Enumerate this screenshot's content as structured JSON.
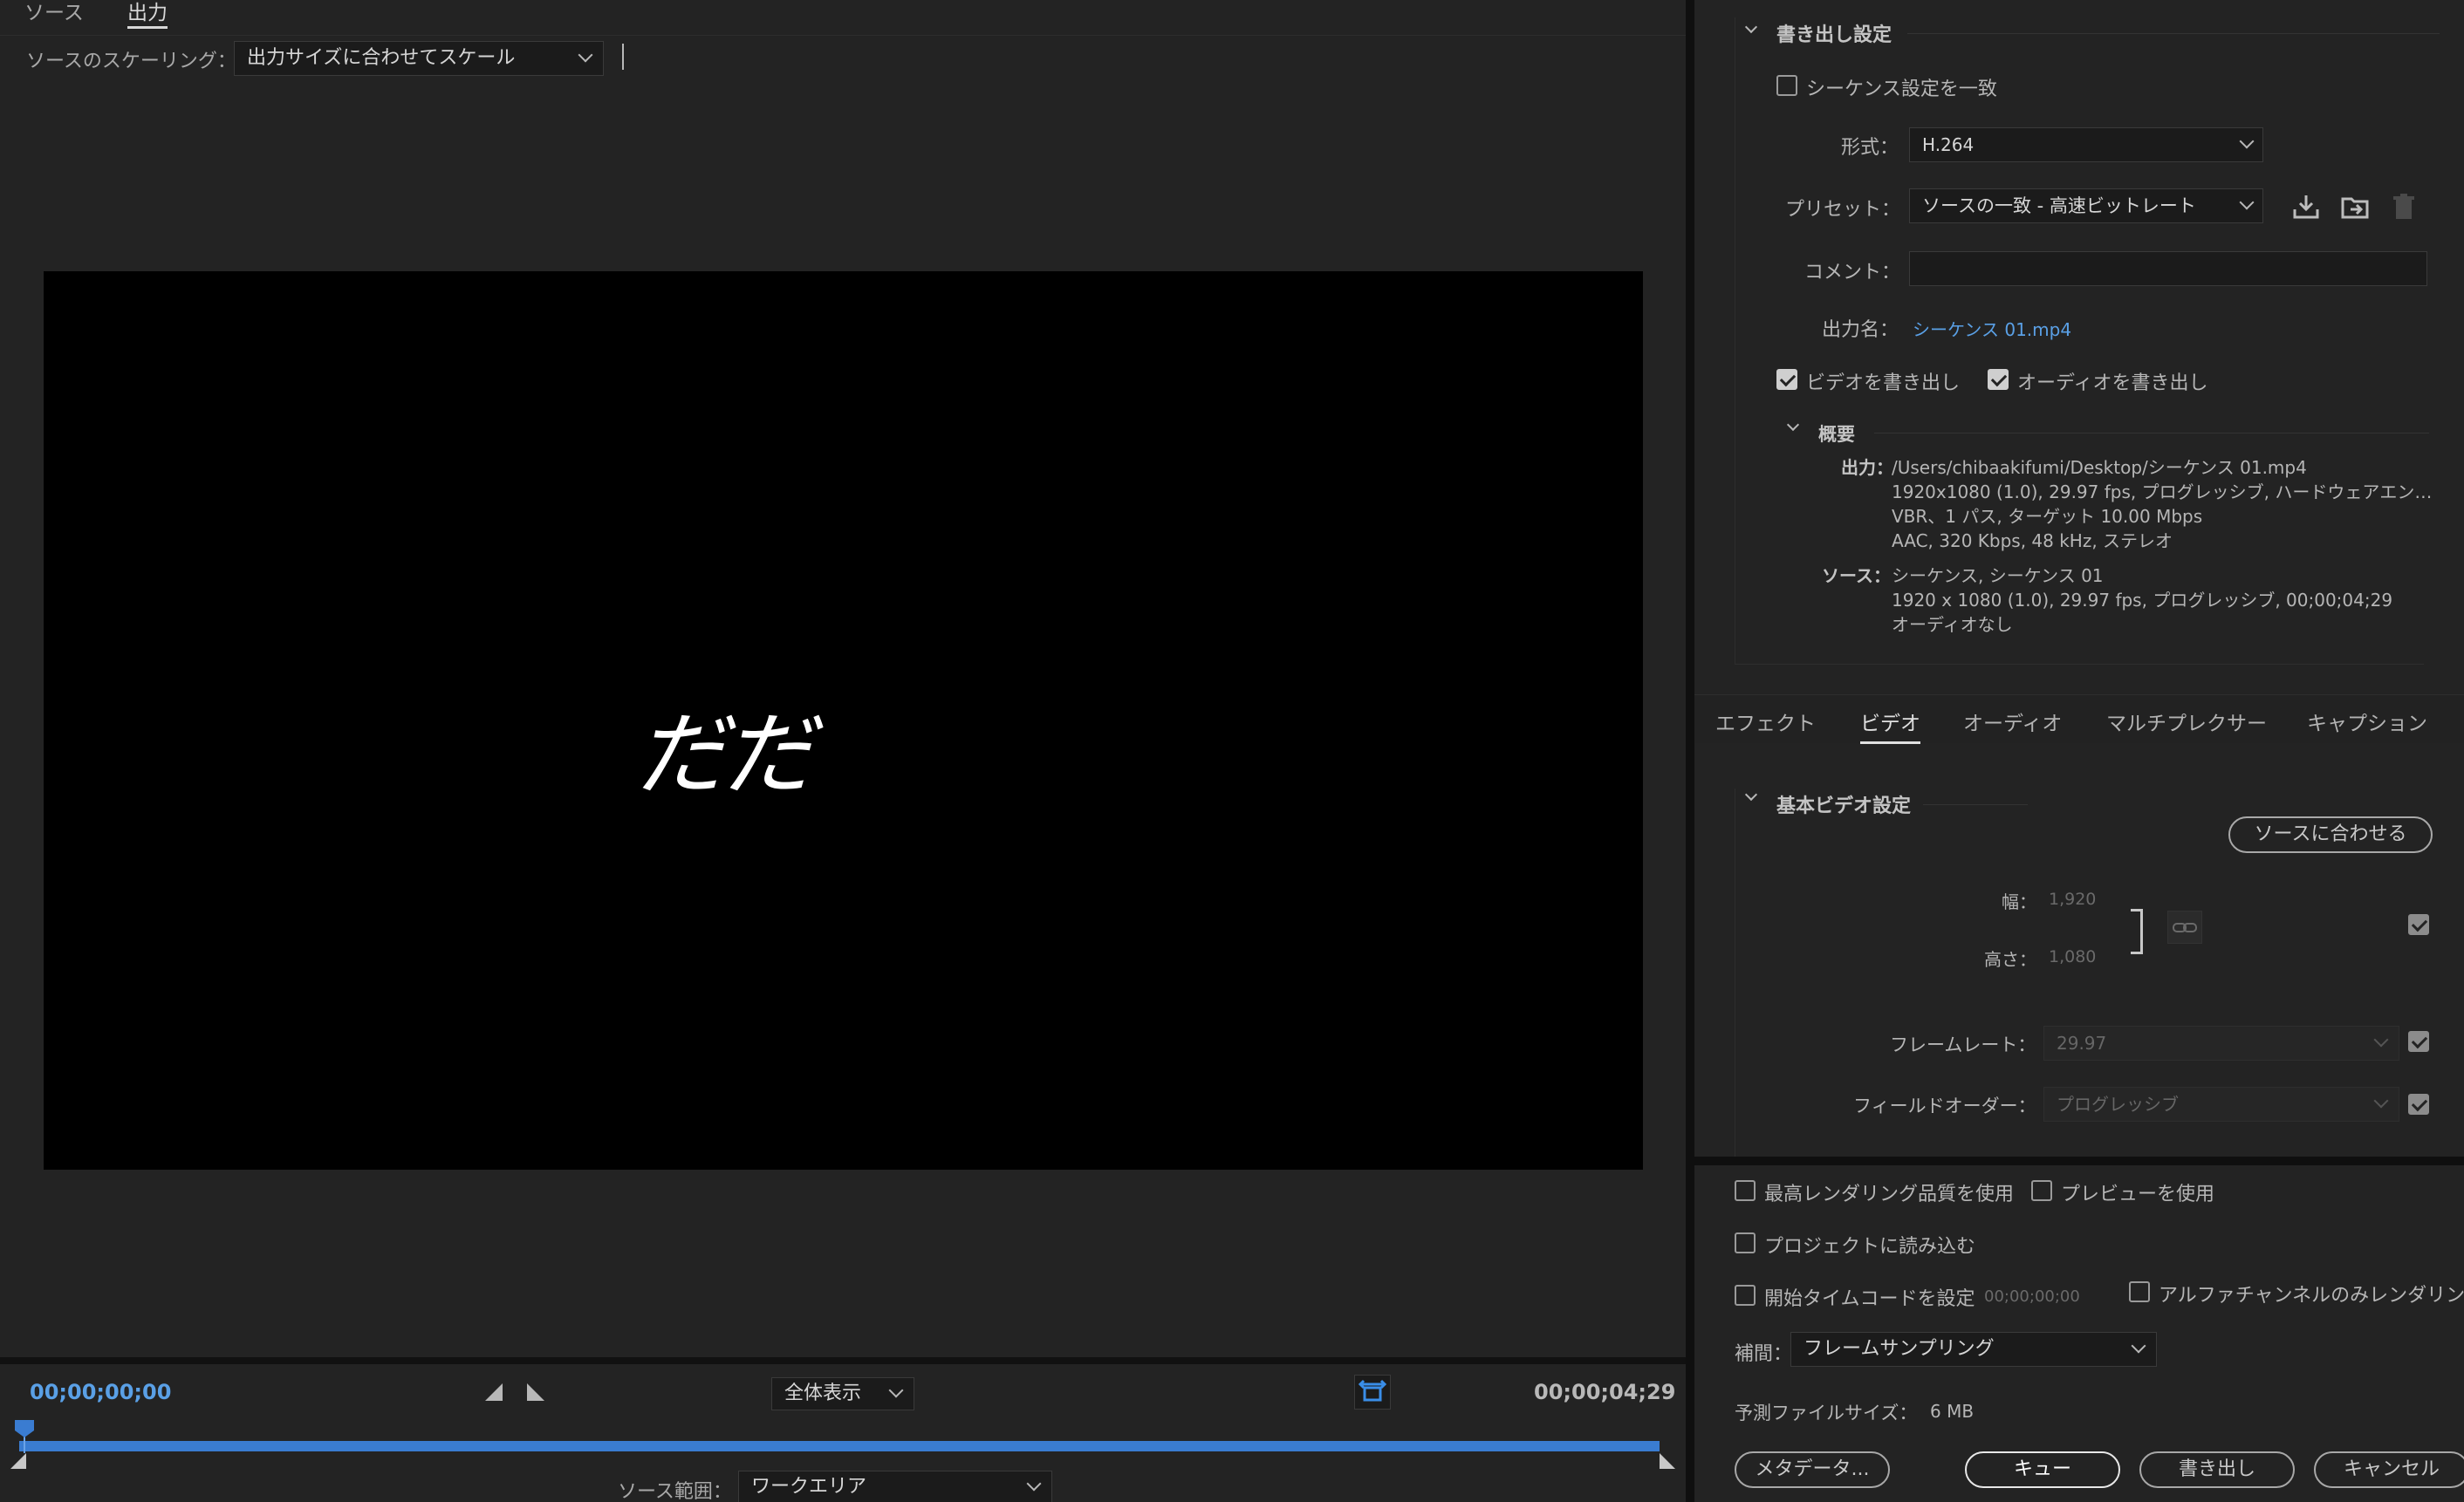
{
  "left": {
    "tabs": [
      "ソース",
      "出力"
    ],
    "scaling_label": "ソースのスケーリング：",
    "scaling_value": "出力サイズに合わせてスケール",
    "preview_text": "だだ",
    "timecode_start": "00;00;00;00",
    "timecode_end": "00;00;04;29",
    "zoom_value": "全体表示",
    "source_range_label": "ソース範囲：",
    "source_range_value": "ワークエリア"
  },
  "export": {
    "section_title": "書き出し設定",
    "match_sequence": "シーケンス設定を一致",
    "format_label": "形式：",
    "format_value": "H.264",
    "preset_label": "プリセット：",
    "preset_value": "ソースの一致 - 高速ビットレート",
    "comment_label": "コメント：",
    "comment_value": "",
    "output_name_label": "出力名：",
    "output_name_value": "シーケンス 01.mp4",
    "export_video": "ビデオを書き出し",
    "export_audio": "オーディオを書き出し",
    "summary_title": "概要",
    "summary_output_label": "出力：",
    "summary_output_lines": [
      "/Users/chibaakifumi/Desktop/シーケンス 01.mp4",
      "1920x1080 (1.0), 29.97 fps, プログレッシブ, ハードウェアエン…",
      "VBR、1 パス, ターゲット 10.00 Mbps",
      "AAC, 320 Kbps, 48 kHz, ステレオ"
    ],
    "summary_source_label": "ソース：",
    "summary_source_lines": [
      "シーケンス, シーケンス 01",
      "1920 x 1080 (1.0), 29.97 fps, プログレッシブ, 00;00;04;29",
      "オーディオなし"
    ]
  },
  "tabs": [
    "エフェクト",
    "ビデオ",
    "オーディオ",
    "マルチプレクサー",
    "キャプション"
  ],
  "video": {
    "section_title": "基本ビデオ設定",
    "match_source_button": "ソースに合わせる",
    "width_label": "幅：",
    "width_value": "1,920",
    "height_label": "高さ：",
    "height_value": "1,080",
    "framerate_label": "フレームレート：",
    "framerate_value": "29.97",
    "field_order_label": "フィールドオーダー：",
    "field_order_value": "プログレッシブ"
  },
  "options": {
    "max_render_quality": "最高レンダリング品質を使用",
    "use_preview": "プレビューを使用",
    "import_to_project": "プロジェクトに読み込む",
    "set_start_timecode": "開始タイムコードを設定",
    "start_timecode_value": "00;00;00;00",
    "alpha_only": "アルファチャンネルのみレンダリン",
    "interpolation_label": "補間：",
    "interpolation_value": "フレームサンプリング",
    "estimated_size_label": "予測ファイルサイズ：",
    "estimated_size_value": "6 MB"
  },
  "buttons": {
    "metadata": "メタデータ...",
    "queue": "キュー",
    "export": "書き出し",
    "cancel": "キャンセル"
  },
  "colors": {
    "accent": "#3a7cd1",
    "link": "#5aa0e6",
    "timecode": "#5aa0e6"
  }
}
